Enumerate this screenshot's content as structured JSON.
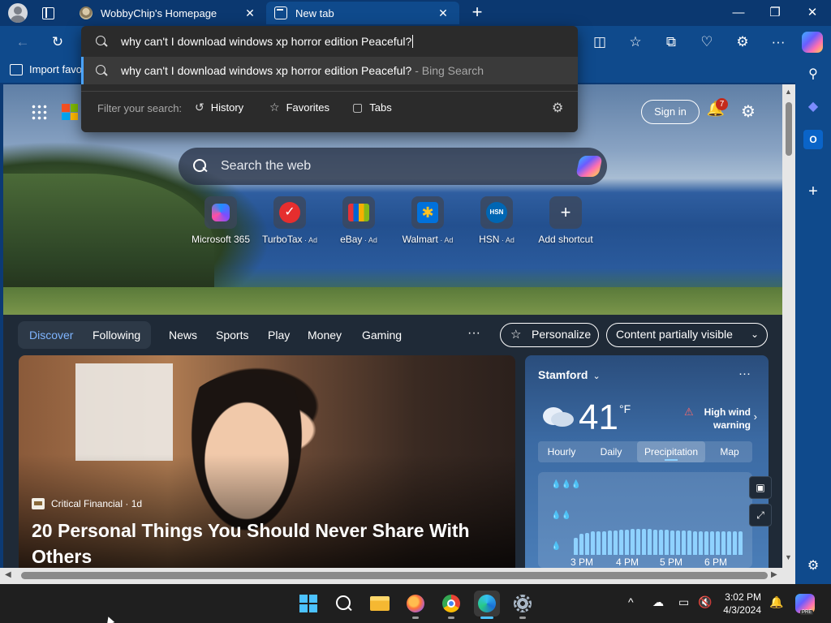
{
  "window": {
    "tabs": [
      {
        "title": "WobbyChip's Homepage",
        "close": "✕"
      },
      {
        "title": "New tab",
        "close": "✕"
      }
    ],
    "new_tab": "+",
    "controls": {
      "minimize": "—",
      "restore": "❐",
      "close": "✕"
    }
  },
  "toolbar": {
    "back": "←",
    "refresh": "↻",
    "split": "◫",
    "favorites": "☆",
    "collections": "⧉",
    "health": "♡",
    "extensions": "⚙",
    "more": "···"
  },
  "favorites_bar": {
    "import_label": "Import favo"
  },
  "omnibox": {
    "query": "why can't I download windows xp horror edition Peaceful?",
    "suggestion": {
      "text": "why can't I download windows xp horror edition Peaceful?",
      "source": " - Bing Search"
    },
    "filter_label": "Filter your search:",
    "filters": [
      {
        "icon": "↺",
        "label": "History"
      },
      {
        "icon": "☆",
        "label": "Favorites"
      },
      {
        "icon": "▢",
        "label": "Tabs"
      }
    ],
    "settings": "⚙"
  },
  "newtab": {
    "signin": "Sign in",
    "notification_count": "7",
    "search_placeholder": "Search the web",
    "shortcuts": [
      {
        "label": "Microsoft 365",
        "ad": ""
      },
      {
        "label": "TurboTax",
        "ad": " · Ad"
      },
      {
        "label": "eBay",
        "ad": " · Ad"
      },
      {
        "label": "Walmart",
        "ad": " · Ad"
      },
      {
        "label": "HSN",
        "ad": " · Ad"
      },
      {
        "label": "Add shortcut",
        "ad": ""
      }
    ],
    "shortcut_glyphs": {
      "turbotax": "✓",
      "walmart": "✱",
      "hsn": "HSN",
      "add": "+"
    }
  },
  "feed_nav": {
    "discover": "Discover",
    "following": "Following",
    "links": [
      "News",
      "Sports",
      "Play",
      "Money",
      "Gaming"
    ],
    "more": "···",
    "personalize": "Personalize",
    "content_visibility": "Content partially visible"
  },
  "article": {
    "source": "Critical Financial · 1d",
    "headline": "20 Personal Things You Should Never Share With Others"
  },
  "weather": {
    "city": "Stamford",
    "temp": "41",
    "unit": "°F",
    "alert": "High wind warning",
    "tabs": [
      "Hourly",
      "Daily",
      "Precipitation",
      "Map"
    ],
    "active_tab": "Precipitation",
    "times": [
      "3 PM",
      "4 PM",
      "5 PM",
      "6 PM"
    ],
    "precip_levels": [
      0.5,
      0.62,
      0.65,
      0.68,
      0.7,
      0.7,
      0.72,
      0.72,
      0.74,
      0.74,
      0.75,
      0.75,
      0.75,
      0.75,
      0.74,
      0.74,
      0.74,
      0.72,
      0.72,
      0.72,
      0.72,
      0.7,
      0.7,
      0.7,
      0.7,
      0.7,
      0.7,
      0.7,
      0.7,
      0.7
    ]
  },
  "taskbar": {
    "clock_time": "3:02 PM",
    "clock_date": "4/3/2024",
    "tray": {
      "chevron": "^",
      "bell": "🔔"
    },
    "copilot_badge": "PRE"
  },
  "colors": {
    "frame": "#0f4a8c",
    "accent": "#4aa3ff",
    "badge": "#c42b1c"
  }
}
